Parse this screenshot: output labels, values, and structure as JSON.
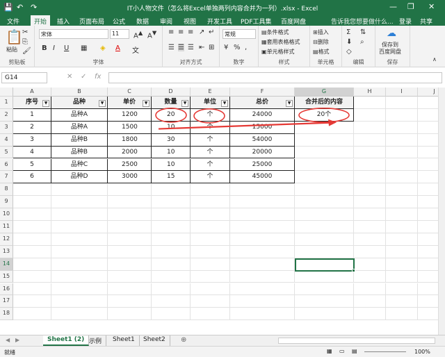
{
  "titlebar": {
    "title": "IT小人物文件（怎么将Excel单独两列内容合并为一列）.xlsx - Excel",
    "save_icon": "save-icon",
    "undo": "↶",
    "redo": "↷",
    "minimize": "—",
    "restore": "❐",
    "close": "✕"
  },
  "tabs": {
    "file": "文件",
    "home": "开始",
    "insert": "插入",
    "layout": "页面布局",
    "formulas": "公式",
    "data": "数据",
    "review": "审阅",
    "view": "视图",
    "dev": "开发工具",
    "pdf": "PDF工具集",
    "baidu": "百度网盘",
    "tell": "告诉我您想要做什么...",
    "login": "登录",
    "share": "共享"
  },
  "ribbon": {
    "clipboard": {
      "paste": "粘贴",
      "label": "剪贴板"
    },
    "font": {
      "name": "宋体",
      "size": "11",
      "bold": "B",
      "italic": "I",
      "underline": "U",
      "label": "字体"
    },
    "align": {
      "label": "对齐方式"
    },
    "number": {
      "format": "常规",
      "percent": "%",
      "comma": ",",
      "label": "数字"
    },
    "styles": {
      "cond": "条件格式",
      "table": "套用表格格式",
      "cell": "单元格样式",
      "label": "样式"
    },
    "cells": {
      "insert": "插入",
      "delete": "删除",
      "format": "格式",
      "label": "单元格"
    },
    "editing": {
      "label": "编辑"
    },
    "save": {
      "line1": "保存到",
      "line2": "百度网盘",
      "label": "保存"
    }
  },
  "formula": {
    "namebox": "G14",
    "cancel": "✕",
    "enter": "✓",
    "fx": "fx",
    "value": ""
  },
  "grid": {
    "columns": [
      "A",
      "B",
      "C",
      "D",
      "E",
      "F",
      "G",
      "H",
      "I",
      "J"
    ],
    "rows": [
      "1",
      "2",
      "3",
      "4",
      "5",
      "6",
      "7",
      "8",
      "9",
      "10",
      "11",
      "12",
      "13",
      "14",
      "15",
      "16",
      "17",
      "18"
    ],
    "headers": [
      "序号",
      "品种",
      "单价",
      "数量",
      "单位",
      "总价",
      "合并后的内容"
    ],
    "data": [
      [
        "1",
        "品种A",
        "1200",
        "20",
        "个",
        "24000",
        "20个"
      ],
      [
        "2",
        "品种A",
        "1500",
        "10",
        "个",
        "15000",
        ""
      ],
      [
        "3",
        "品种B",
        "1800",
        "30",
        "个",
        "54000",
        ""
      ],
      [
        "4",
        "品种B",
        "2000",
        "10",
        "个",
        "20000",
        ""
      ],
      [
        "5",
        "品种C",
        "2500",
        "10",
        "个",
        "25000",
        ""
      ],
      [
        "6",
        "品种D",
        "3000",
        "15",
        "个",
        "45000",
        ""
      ]
    ],
    "selected_col": "G",
    "selected_row": "14"
  },
  "sheets": {
    "tabs": [
      "Sheet1 (2)",
      "示例",
      "Sheet1",
      "Sheet2"
    ],
    "active": "Sheet1 (2)",
    "add": "⊕"
  },
  "status": {
    "ready": "就绪",
    "zoom": "100%"
  },
  "colors": {
    "accent": "#217346",
    "annotation": "#e53935"
  }
}
